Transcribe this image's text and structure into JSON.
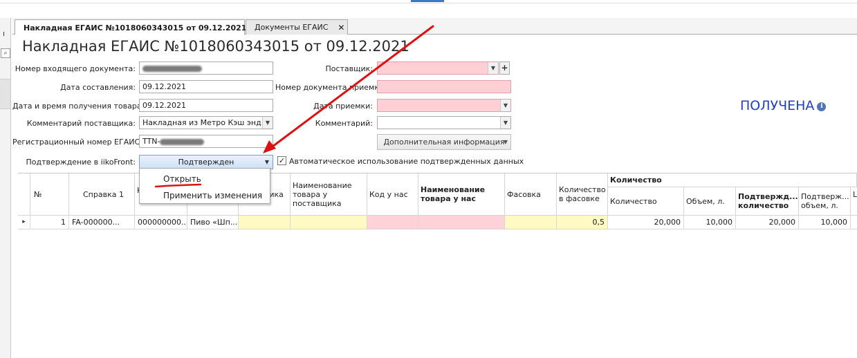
{
  "left_strip": {
    "glyph": "ı",
    "search_icon": "⌕"
  },
  "tabs": [
    {
      "label": "Накладная ЕГАИС №1018060343015 от 09.12.2021",
      "close": "✕",
      "active": true
    },
    {
      "label": "Документы ЕГАИС",
      "close": "✕",
      "active": false
    }
  ],
  "page_title": "Накладная ЕГАИС №1018060343015 от 09.12.2021",
  "form_left": {
    "incoming_doc_label": "Номер входящего документа:",
    "compiled_date_label": "Дата составления:",
    "compiled_date_value": "09.12.2021",
    "received_datetime_label": "Дата и время получения товара:",
    "received_datetime_value": "09.12.2021",
    "supplier_comment_label": "Комментарий поставщика:",
    "supplier_comment_value": "Накладная из Метро Кэш энд ...",
    "egais_reg_label": "Регистрационный номер ЕГАИС:",
    "egais_reg_value": "TTN-",
    "iikofront_confirm_label": "Подтверждение в iikoFront:",
    "iikofront_confirm_value": "Подтвержден"
  },
  "form_right": {
    "supplier_label": "Поставщик:",
    "acceptance_doc_label": "Номер документа приемки:",
    "acceptance_date_label": "Дата приемки:",
    "comment_label": "Комментарий:",
    "additional_info_button": "Дополнительная информация"
  },
  "status": {
    "text": "ПОЛУЧЕНА",
    "info_glyph": "i"
  },
  "auto_use_checkbox": {
    "label": "Автоматическое использование подтвержденных данных",
    "checked": true,
    "mark": "✓"
  },
  "dropdown_menu": {
    "items": [
      "Открыть",
      "Применить изменения"
    ]
  },
  "grid": {
    "headers": {
      "num": "№",
      "ref1": "Справка 1",
      "k_short": "К в",
      "supplier_product_partial": "щика",
      "supplier_product_name": "Наименование товара у поставщика",
      "our_code": "Код у нас",
      "our_product_name": "Наименование товара у нас",
      "packing": "Фасовка",
      "qty_in_pack": "Количество в фасовке",
      "qty_group": "Количество",
      "qty": "Количество",
      "volume": "Объем, л.",
      "confirmed_qty": "Подтвержд... количество",
      "confirmed_volume": "Подтверж... объем, л.",
      "last_partial": "L"
    },
    "row": {
      "indicator": "▸",
      "num": "1",
      "ref1": "FA-000000...",
      "k": "000000000...",
      "product": "Пиво «Шп...",
      "qty_in_pack": "0,5",
      "qty": "20,000",
      "volume": "10,000",
      "confirmed_qty": "20,000",
      "confirmed_volume": "10,000"
    }
  },
  "colors": {
    "required": "#ffcfd6",
    "highlight": "#fff9c4",
    "status": "#1f3fbf",
    "annotation": "#e01010"
  }
}
